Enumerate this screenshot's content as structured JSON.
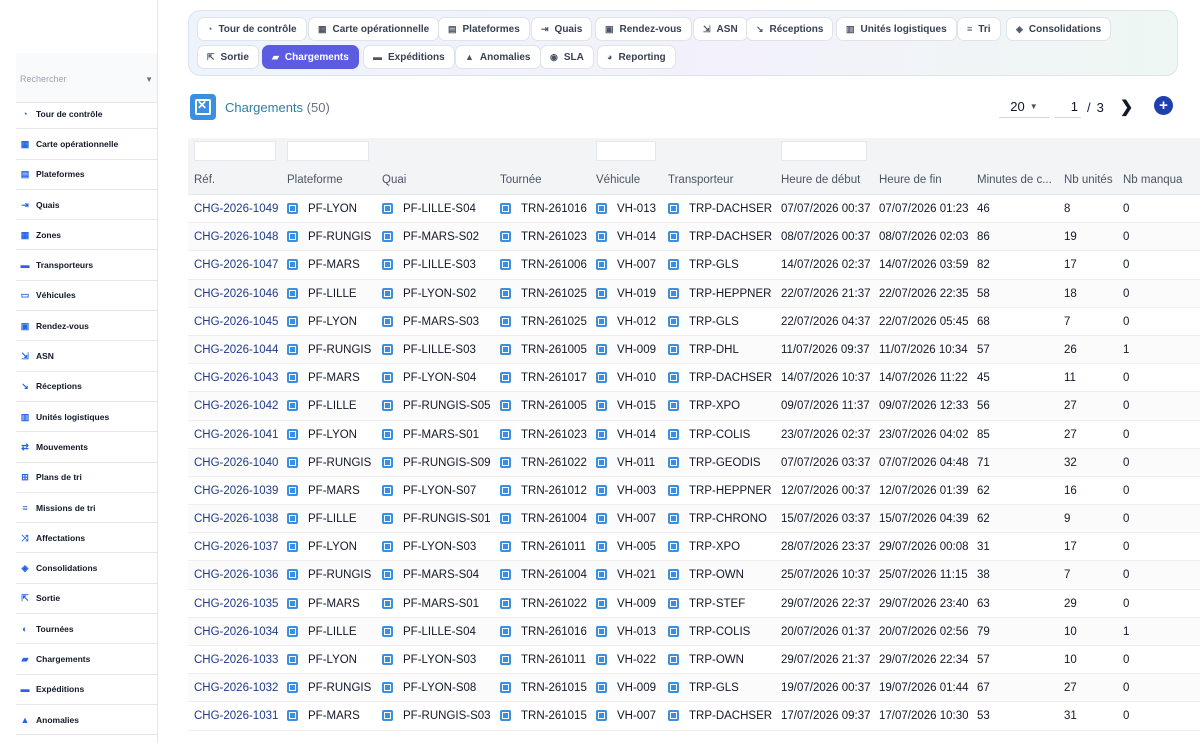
{
  "sidebar": {
    "search_placeholder": "Rechercher",
    "items": [
      {
        "label": "Tour de contrôle",
        "icon": "speedometer-icon"
      },
      {
        "label": "Carte opérationnelle",
        "icon": "map-icon"
      },
      {
        "label": "Plateformes",
        "icon": "warehouse-icon"
      },
      {
        "label": "Quais",
        "icon": "dock-icon"
      },
      {
        "label": "Zones",
        "icon": "grid-icon"
      },
      {
        "label": "Transporteurs",
        "icon": "truck-icon"
      },
      {
        "label": "Véhicules",
        "icon": "bus-icon"
      },
      {
        "label": "Rendez-vous",
        "icon": "calendar-icon"
      },
      {
        "label": "ASN",
        "icon": "asn-icon"
      },
      {
        "label": "Réceptions",
        "icon": "receiving-icon"
      },
      {
        "label": "Unités logistiques",
        "icon": "pallet-icon"
      },
      {
        "label": "Mouvements",
        "icon": "transfer-icon"
      },
      {
        "label": "Plans de tri",
        "icon": "sitemap-icon"
      },
      {
        "label": "Missions de tri",
        "icon": "list-icon"
      },
      {
        "label": "Affectations",
        "icon": "shuffle-icon"
      },
      {
        "label": "Consolidations",
        "icon": "layers-icon"
      },
      {
        "label": "Sortie",
        "icon": "exit-icon"
      },
      {
        "label": "Tournées",
        "icon": "route-icon"
      },
      {
        "label": "Chargements",
        "icon": "loading-icon"
      },
      {
        "label": "Expéditions",
        "icon": "shipping-icon"
      },
      {
        "label": "Anomalies",
        "icon": "warning-icon"
      }
    ]
  },
  "tabs": [
    {
      "label": "Tour de contrôle",
      "icon": "speedometer-icon",
      "active": false
    },
    {
      "label": "Carte opérationnelle",
      "icon": "map-icon",
      "active": false
    },
    {
      "label": "Plateformes",
      "icon": "warehouse-icon",
      "active": false
    },
    {
      "label": "Quais",
      "icon": "dock-icon",
      "active": false
    },
    {
      "label": "Rendez-vous",
      "icon": "calendar-icon",
      "active": false
    },
    {
      "label": "ASN",
      "icon": "asn-icon",
      "active": false
    },
    {
      "label": "Réceptions",
      "icon": "receiving-icon",
      "active": false
    },
    {
      "label": "Unités logistiques",
      "icon": "pallet-icon",
      "active": false
    },
    {
      "label": "Tri",
      "icon": "list-icon",
      "active": false
    },
    {
      "label": "Consolidations",
      "icon": "layers-icon",
      "active": false
    },
    {
      "label": "Sortie",
      "icon": "exit-icon",
      "active": false
    },
    {
      "label": "Chargements",
      "icon": "loading-icon",
      "active": true
    },
    {
      "label": "Expéditions",
      "icon": "shipping-icon",
      "active": false
    },
    {
      "label": "Anomalies",
      "icon": "warning-icon",
      "active": false
    },
    {
      "label": "SLA",
      "icon": "stopwatch-icon",
      "active": false
    },
    {
      "label": "Reporting",
      "icon": "chart-pie-icon",
      "active": false
    }
  ],
  "page": {
    "title": "Chargements",
    "count": "(50)",
    "page_size": "20",
    "current_page": "1",
    "separator": "/",
    "total_pages": "3",
    "next_icon": "chevron-right-icon",
    "add_icon": "plus-circle-icon"
  },
  "colors": {
    "accent": "#5b5ce2",
    "link": "#1e3a8a",
    "title": "#2e7ea8",
    "ref_icon": "#3b8fe0"
  },
  "table": {
    "headers": [
      "Réf.",
      "Plateforme",
      "Quai",
      "Tournée",
      "Véhicule",
      "Transporteur",
      "Heure de début",
      "Heure de fin",
      "Minutes de c...",
      "Nb unités",
      "Nb manqua"
    ],
    "rows": [
      [
        "CHG-2026-1049",
        "PF-LYON",
        "PF-LILLE-S04",
        "TRN-261016",
        "VH-013",
        "TRP-DACHSER",
        "07/07/2026 00:37",
        "07/07/2026 01:23",
        "46",
        "8",
        "0"
      ],
      [
        "CHG-2026-1048",
        "PF-RUNGIS",
        "PF-MARS-S02",
        "TRN-261023",
        "VH-014",
        "TRP-DACHSER",
        "08/07/2026 00:37",
        "08/07/2026 02:03",
        "86",
        "19",
        "0"
      ],
      [
        "CHG-2026-1047",
        "PF-MARS",
        "PF-LILLE-S03",
        "TRN-261006",
        "VH-007",
        "TRP-GLS",
        "14/07/2026 02:37",
        "14/07/2026 03:59",
        "82",
        "17",
        "0"
      ],
      [
        "CHG-2026-1046",
        "PF-LILLE",
        "PF-LYON-S02",
        "TRN-261025",
        "VH-019",
        "TRP-HEPPNER",
        "22/07/2026 21:37",
        "22/07/2026 22:35",
        "58",
        "18",
        "0"
      ],
      [
        "CHG-2026-1045",
        "PF-LYON",
        "PF-MARS-S03",
        "TRN-261025",
        "VH-012",
        "TRP-GLS",
        "22/07/2026 04:37",
        "22/07/2026 05:45",
        "68",
        "7",
        "0"
      ],
      [
        "CHG-2026-1044",
        "PF-RUNGIS",
        "PF-LILLE-S03",
        "TRN-261005",
        "VH-009",
        "TRP-DHL",
        "11/07/2026 09:37",
        "11/07/2026 10:34",
        "57",
        "26",
        "1"
      ],
      [
        "CHG-2026-1043",
        "PF-MARS",
        "PF-LYON-S04",
        "TRN-261017",
        "VH-010",
        "TRP-DACHSER",
        "14/07/2026 10:37",
        "14/07/2026 11:22",
        "45",
        "11",
        "0"
      ],
      [
        "CHG-2026-1042",
        "PF-LILLE",
        "PF-RUNGIS-S05",
        "TRN-261005",
        "VH-015",
        "TRP-XPO",
        "09/07/2026 11:37",
        "09/07/2026 12:33",
        "56",
        "27",
        "0"
      ],
      [
        "CHG-2026-1041",
        "PF-LYON",
        "PF-MARS-S01",
        "TRN-261023",
        "VH-014",
        "TRP-COLIS",
        "23/07/2026 02:37",
        "23/07/2026 04:02",
        "85",
        "27",
        "0"
      ],
      [
        "CHG-2026-1040",
        "PF-RUNGIS",
        "PF-RUNGIS-S09",
        "TRN-261022",
        "VH-011",
        "TRP-GEODIS",
        "07/07/2026 03:37",
        "07/07/2026 04:48",
        "71",
        "32",
        "0"
      ],
      [
        "CHG-2026-1039",
        "PF-MARS",
        "PF-LYON-S07",
        "TRN-261012",
        "VH-003",
        "TRP-HEPPNER",
        "12/07/2026 00:37",
        "12/07/2026 01:39",
        "62",
        "16",
        "0"
      ],
      [
        "CHG-2026-1038",
        "PF-LILLE",
        "PF-RUNGIS-S01",
        "TRN-261004",
        "VH-007",
        "TRP-CHRONO",
        "15/07/2026 03:37",
        "15/07/2026 04:39",
        "62",
        "9",
        "0"
      ],
      [
        "CHG-2026-1037",
        "PF-LYON",
        "PF-LYON-S03",
        "TRN-261011",
        "VH-005",
        "TRP-XPO",
        "28/07/2026 23:37",
        "29/07/2026 00:08",
        "31",
        "17",
        "0"
      ],
      [
        "CHG-2026-1036",
        "PF-RUNGIS",
        "PF-MARS-S04",
        "TRN-261004",
        "VH-021",
        "TRP-OWN",
        "25/07/2026 10:37",
        "25/07/2026 11:15",
        "38",
        "7",
        "0"
      ],
      [
        "CHG-2026-1035",
        "PF-MARS",
        "PF-MARS-S01",
        "TRN-261022",
        "VH-009",
        "TRP-STEF",
        "29/07/2026 22:37",
        "29/07/2026 23:40",
        "63",
        "29",
        "0"
      ],
      [
        "CHG-2026-1034",
        "PF-LILLE",
        "PF-LILLE-S04",
        "TRN-261016",
        "VH-013",
        "TRP-COLIS",
        "20/07/2026 01:37",
        "20/07/2026 02:56",
        "79",
        "10",
        "1"
      ],
      [
        "CHG-2026-1033",
        "PF-LYON",
        "PF-LYON-S03",
        "TRN-261011",
        "VH-022",
        "TRP-OWN",
        "29/07/2026 21:37",
        "29/07/2026 22:34",
        "57",
        "10",
        "0"
      ],
      [
        "CHG-2026-1032",
        "PF-RUNGIS",
        "PF-LYON-S08",
        "TRN-261015",
        "VH-009",
        "TRP-GLS",
        "19/07/2026 00:37",
        "19/07/2026 01:44",
        "67",
        "27",
        "0"
      ],
      [
        "CHG-2026-1031",
        "PF-MARS",
        "PF-RUNGIS-S03",
        "TRN-261015",
        "VH-007",
        "TRP-DACHSER",
        "17/07/2026 09:37",
        "17/07/2026 10:30",
        "53",
        "31",
        "0"
      ]
    ]
  }
}
